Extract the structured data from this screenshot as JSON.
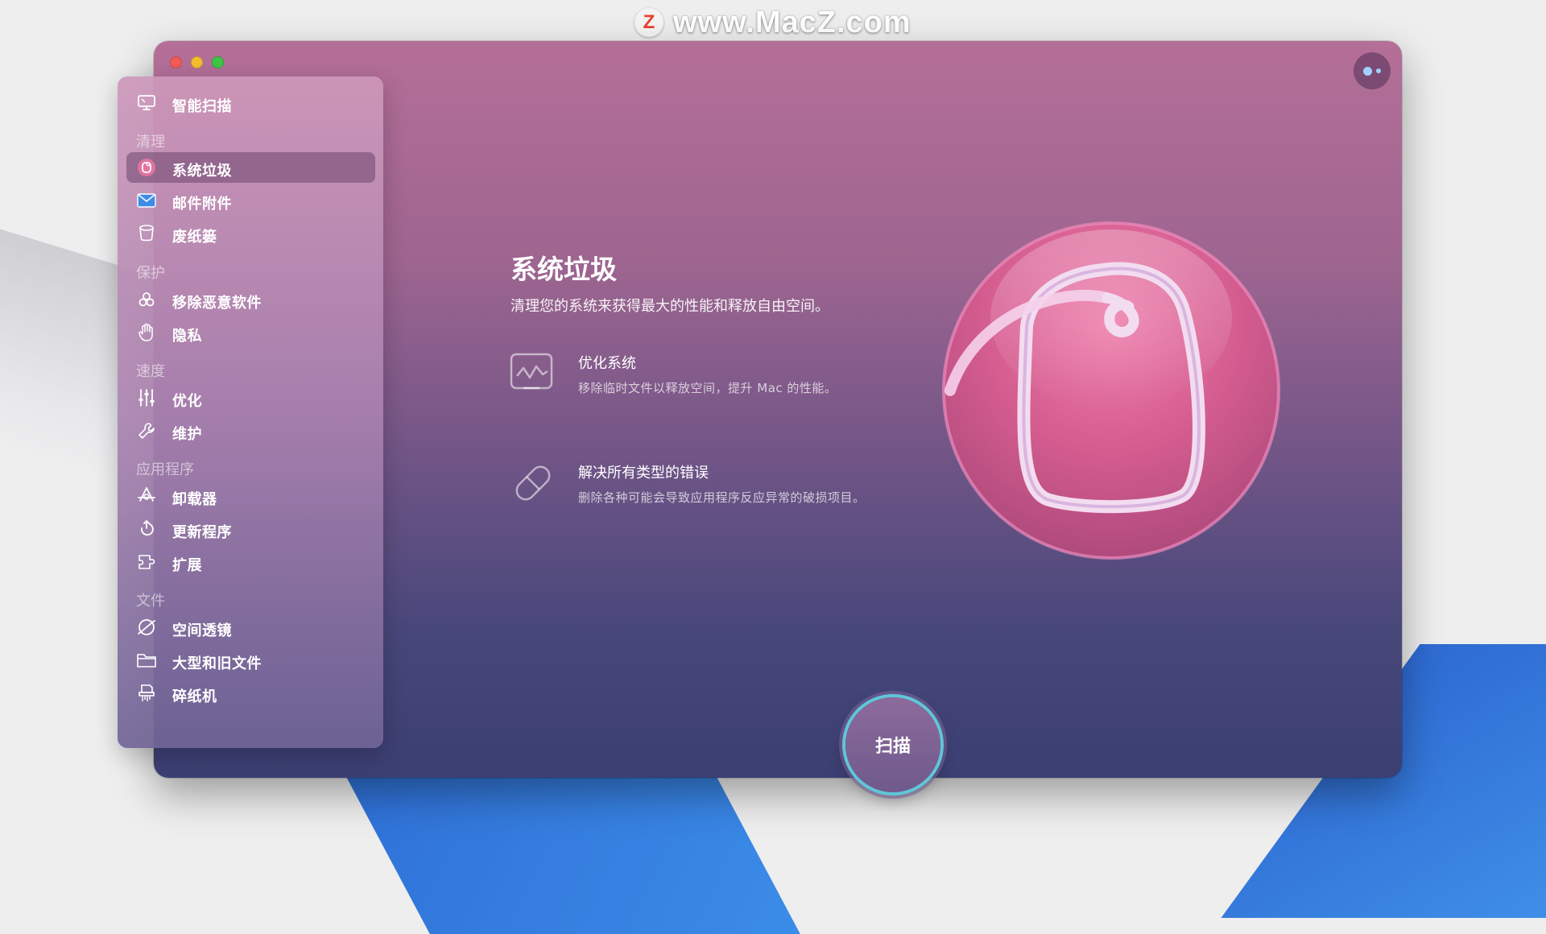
{
  "watermark": {
    "logo_letter": "Z",
    "text": "www.MacZ.com"
  },
  "sidebar": {
    "top_item": {
      "label": "智能扫描",
      "icon": "monitor-icon"
    },
    "sections": [
      {
        "title": "清理",
        "items": [
          {
            "label": "系统垃圾",
            "icon": "system-junk-icon",
            "active": true
          },
          {
            "label": "邮件附件",
            "icon": "mail-icon"
          },
          {
            "label": "废纸篓",
            "icon": "trash-icon"
          }
        ]
      },
      {
        "title": "保护",
        "items": [
          {
            "label": "移除恶意软件",
            "icon": "biohazard-icon"
          },
          {
            "label": "隐私",
            "icon": "hand-icon"
          }
        ]
      },
      {
        "title": "速度",
        "items": [
          {
            "label": "优化",
            "icon": "sliders-icon"
          },
          {
            "label": "维护",
            "icon": "wrench-icon"
          }
        ]
      },
      {
        "title": "应用程序",
        "items": [
          {
            "label": "卸载器",
            "icon": "uninstaller-icon"
          },
          {
            "label": "更新程序",
            "icon": "updater-icon"
          },
          {
            "label": "扩展",
            "icon": "extensions-icon"
          }
        ]
      },
      {
        "title": "文件",
        "items": [
          {
            "label": "空间透镜",
            "icon": "space-lens-icon"
          },
          {
            "label": "大型和旧文件",
            "icon": "folder-icon"
          },
          {
            "label": "碎纸机",
            "icon": "shredder-icon"
          }
        ]
      }
    ]
  },
  "main": {
    "title": "系统垃圾",
    "subtitle": "清理您的系统来获得最大的性能和释放自由空间。",
    "features": [
      {
        "title": "优化系统",
        "desc": "移除临时文件以释放空间，提升 Mac 的性能。",
        "icon": "system-monitor-icon"
      },
      {
        "title": "解决所有类型的错误",
        "desc": "删除各种可能会导致应用程序反应异常的破损项目。",
        "icon": "pill-icon"
      }
    ],
    "hero_icon": "system-junk-hero-icon"
  },
  "scan_button": {
    "label": "扫描"
  },
  "colors": {
    "accent_ring": "#5fc6d8",
    "hero_pink": "#e0709e"
  }
}
